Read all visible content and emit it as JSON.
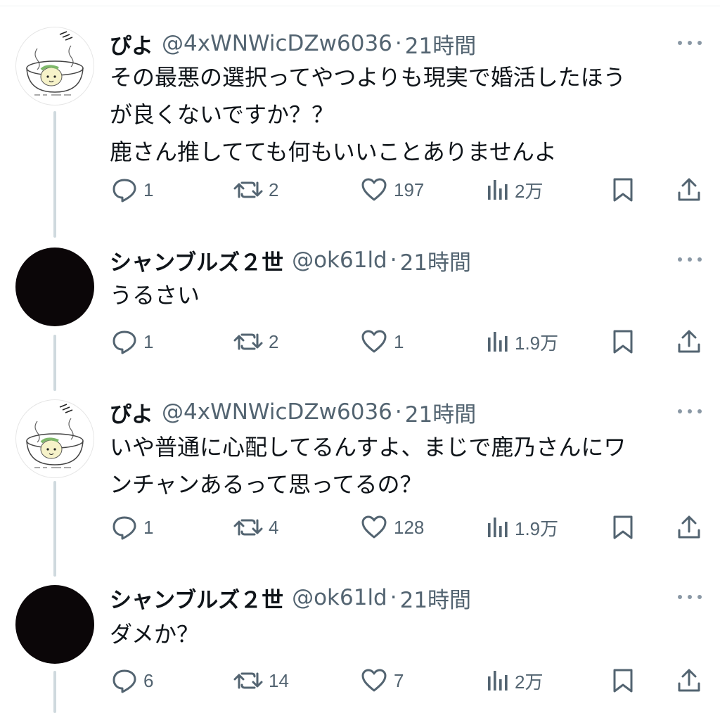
{
  "tweets": [
    {
      "name": "ぴよ",
      "handle": "@4xWNWicDZw6036",
      "separator": "·",
      "time": "21時間",
      "lines": [
        "その最悪の選択ってやつよりも現実で婚活したほう",
        "が良くないですか？？",
        "鹿さん推してても何もいいことありませんよ"
      ],
      "replies": "1",
      "reposts": "2",
      "likes": "197",
      "views": "2万",
      "avatar": "sketch-soup-bowl-avatar"
    },
    {
      "name": "シャンブルズ２世",
      "handle": "@ok61ld",
      "separator": "·",
      "time": "21時間",
      "lines": [
        "うるさい"
      ],
      "replies": "1",
      "reposts": "2",
      "likes": "1",
      "views": "1.9万",
      "avatar": "dark-avatar"
    },
    {
      "name": "ぴよ",
      "handle": "@4xWNWicDZw6036",
      "separator": "·",
      "time": "21時間",
      "lines": [
        "いや普通に心配してるんすよ、まじで鹿乃さんにワ",
        "ンチャンあるって思ってるの？"
      ],
      "replies": "1",
      "reposts": "4",
      "likes": "128",
      "views": "1.9万",
      "avatar": "sketch-soup-bowl-avatar"
    },
    {
      "name": "シャンブルズ２世",
      "handle": "@ok61ld",
      "separator": "·",
      "time": "21時間",
      "lines": [
        "ダメか？"
      ],
      "replies": "6",
      "reposts": "14",
      "likes": "7",
      "views": "2万",
      "avatar": "dark-avatar"
    }
  ],
  "icons": {
    "reply": "reply-bubble-icon",
    "repost": "repost-arrows-icon",
    "like": "heart-icon",
    "views": "analytics-bars-icon",
    "bookmark": "bookmark-icon",
    "share": "share-upload-icon",
    "more": "more-dots-icon"
  },
  "colors": {
    "text": "#0f1419",
    "secondary": "#536471",
    "thread_line": "#cfd9de",
    "divider": "#eff3f4"
  }
}
